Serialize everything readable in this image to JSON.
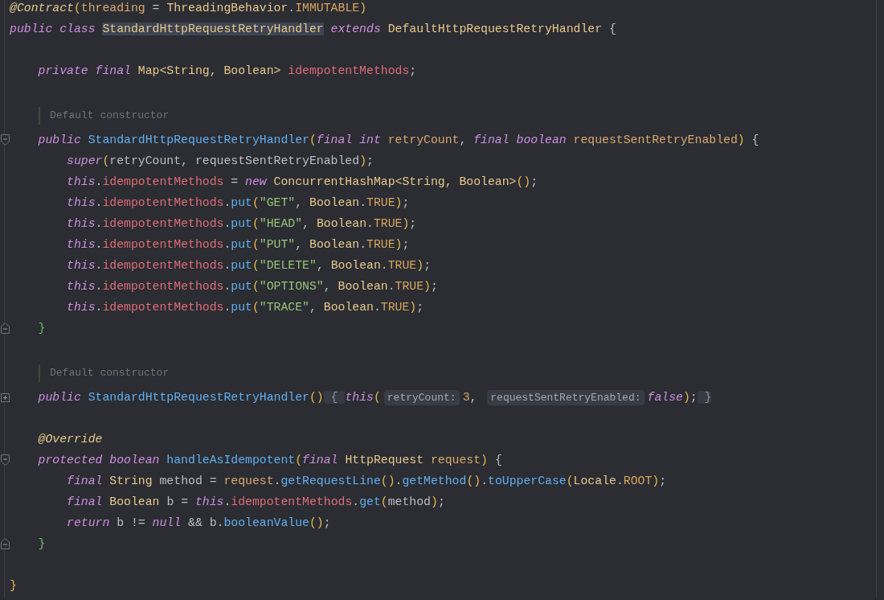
{
  "editor": {
    "lines": [
      {
        "kind": "code",
        "tokens": [
          {
            "kind": "ann",
            "text": "@Contract"
          },
          {
            "kind": "paren",
            "text": "("
          },
          {
            "kind": "param",
            "text": "threading"
          },
          {
            "kind": "plain",
            "text": " = "
          },
          {
            "kind": "type",
            "text": "ThreadingBehavior"
          },
          {
            "kind": "plain",
            "text": "."
          },
          {
            "kind": "const",
            "text": "IMMUTABLE"
          },
          {
            "kind": "paren",
            "text": ")"
          }
        ]
      },
      {
        "kind": "code",
        "tokens": [
          {
            "kind": "kw",
            "text": "public class "
          },
          {
            "kind": "hl",
            "text": "StandardHttpRequestRetryHandler"
          },
          {
            "kind": "kw",
            "text": " extends "
          },
          {
            "kind": "type",
            "text": "DefaultHttpRequestRetryHandler"
          },
          {
            "kind": "plain",
            "text": " {"
          }
        ]
      },
      {
        "kind": "blank"
      },
      {
        "kind": "code",
        "tokens": [
          {
            "kind": "kw",
            "text": "    private final "
          },
          {
            "kind": "type",
            "text": "Map<String, Boolean> "
          },
          {
            "kind": "field",
            "text": "idempotentMethods"
          },
          {
            "kind": "plain",
            "text": ";"
          }
        ]
      },
      {
        "kind": "blank"
      },
      {
        "kind": "doc",
        "text": "Default constructor"
      },
      {
        "kind": "fold-start",
        "tokens": [
          {
            "kind": "kw",
            "text": "    public "
          },
          {
            "kind": "fn",
            "text": "StandardHttpRequestRetryHandler"
          },
          {
            "kind": "paren",
            "text": "("
          },
          {
            "kind": "kw",
            "text": "final int "
          },
          {
            "kind": "param",
            "text": "retryCount"
          },
          {
            "kind": "plain",
            "text": ", "
          },
          {
            "kind": "kw",
            "text": "final boolean "
          },
          {
            "kind": "param",
            "text": "requestSentRetryEnabled"
          },
          {
            "kind": "paren",
            "text": ")"
          },
          {
            "kind": "plain",
            "text": " {"
          }
        ]
      },
      {
        "kind": "code",
        "tokens": [
          {
            "kind": "kw",
            "text": "        super"
          },
          {
            "kind": "paren",
            "text": "("
          },
          {
            "kind": "plain",
            "text": "retryCount, requestSentRetryEnabled"
          },
          {
            "kind": "paren",
            "text": ")"
          },
          {
            "kind": "plain",
            "text": ";"
          }
        ]
      },
      {
        "kind": "code",
        "tokens": [
          {
            "kind": "kw",
            "text": "        this"
          },
          {
            "kind": "plain",
            "text": "."
          },
          {
            "kind": "field",
            "text": "idempotentMethods"
          },
          {
            "kind": "plain",
            "text": " = "
          },
          {
            "kind": "kw",
            "text": "new "
          },
          {
            "kind": "type",
            "text": "ConcurrentHashMap<String, Boolean>"
          },
          {
            "kind": "paren",
            "text": "()"
          },
          {
            "kind": "plain",
            "text": ";"
          }
        ]
      },
      {
        "kind": "code",
        "tokens": [
          {
            "kind": "kw",
            "text": "        this"
          },
          {
            "kind": "plain",
            "text": "."
          },
          {
            "kind": "field",
            "text": "idempotentMethods"
          },
          {
            "kind": "plain",
            "text": "."
          },
          {
            "kind": "fn",
            "text": "put"
          },
          {
            "kind": "paren",
            "text": "("
          },
          {
            "kind": "str",
            "text": "\"GET\""
          },
          {
            "kind": "plain",
            "text": ", "
          },
          {
            "kind": "type",
            "text": "Boolean"
          },
          {
            "kind": "plain",
            "text": "."
          },
          {
            "kind": "const",
            "text": "TRUE"
          },
          {
            "kind": "paren",
            "text": ")"
          },
          {
            "kind": "plain",
            "text": ";"
          }
        ]
      },
      {
        "kind": "code",
        "tokens": [
          {
            "kind": "kw",
            "text": "        this"
          },
          {
            "kind": "plain",
            "text": "."
          },
          {
            "kind": "field",
            "text": "idempotentMethods"
          },
          {
            "kind": "plain",
            "text": "."
          },
          {
            "kind": "fn",
            "text": "put"
          },
          {
            "kind": "paren",
            "text": "("
          },
          {
            "kind": "str",
            "text": "\"HEAD\""
          },
          {
            "kind": "plain",
            "text": ", "
          },
          {
            "kind": "type",
            "text": "Boolean"
          },
          {
            "kind": "plain",
            "text": "."
          },
          {
            "kind": "const",
            "text": "TRUE"
          },
          {
            "kind": "paren",
            "text": ")"
          },
          {
            "kind": "plain",
            "text": ";"
          }
        ]
      },
      {
        "kind": "code",
        "tokens": [
          {
            "kind": "kw",
            "text": "        this"
          },
          {
            "kind": "plain",
            "text": "."
          },
          {
            "kind": "field",
            "text": "idempotentMethods"
          },
          {
            "kind": "plain",
            "text": "."
          },
          {
            "kind": "fn",
            "text": "put"
          },
          {
            "kind": "paren",
            "text": "("
          },
          {
            "kind": "str",
            "text": "\"PUT\""
          },
          {
            "kind": "plain",
            "text": ", "
          },
          {
            "kind": "type",
            "text": "Boolean"
          },
          {
            "kind": "plain",
            "text": "."
          },
          {
            "kind": "const",
            "text": "TRUE"
          },
          {
            "kind": "paren",
            "text": ")"
          },
          {
            "kind": "plain",
            "text": ";"
          }
        ]
      },
      {
        "kind": "code",
        "tokens": [
          {
            "kind": "kw",
            "text": "        this"
          },
          {
            "kind": "plain",
            "text": "."
          },
          {
            "kind": "field",
            "text": "idempotentMethods"
          },
          {
            "kind": "plain",
            "text": "."
          },
          {
            "kind": "fn",
            "text": "put"
          },
          {
            "kind": "paren",
            "text": "("
          },
          {
            "kind": "str",
            "text": "\"DELETE\""
          },
          {
            "kind": "plain",
            "text": ", "
          },
          {
            "kind": "type",
            "text": "Boolean"
          },
          {
            "kind": "plain",
            "text": "."
          },
          {
            "kind": "const",
            "text": "TRUE"
          },
          {
            "kind": "paren",
            "text": ")"
          },
          {
            "kind": "plain",
            "text": ";"
          }
        ]
      },
      {
        "kind": "code",
        "tokens": [
          {
            "kind": "kw",
            "text": "        this"
          },
          {
            "kind": "plain",
            "text": "."
          },
          {
            "kind": "field",
            "text": "idempotentMethods"
          },
          {
            "kind": "plain",
            "text": "."
          },
          {
            "kind": "fn",
            "text": "put"
          },
          {
            "kind": "paren",
            "text": "("
          },
          {
            "kind": "str",
            "text": "\"OPTIONS\""
          },
          {
            "kind": "plain",
            "text": ", "
          },
          {
            "kind": "type",
            "text": "Boolean"
          },
          {
            "kind": "plain",
            "text": "."
          },
          {
            "kind": "const",
            "text": "TRUE"
          },
          {
            "kind": "paren",
            "text": ")"
          },
          {
            "kind": "plain",
            "text": ";"
          }
        ]
      },
      {
        "kind": "code",
        "tokens": [
          {
            "kind": "kw",
            "text": "        this"
          },
          {
            "kind": "plain",
            "text": "."
          },
          {
            "kind": "field",
            "text": "idempotentMethods"
          },
          {
            "kind": "plain",
            "text": "."
          },
          {
            "kind": "fn",
            "text": "put"
          },
          {
            "kind": "paren",
            "text": "("
          },
          {
            "kind": "str",
            "text": "\"TRACE\""
          },
          {
            "kind": "plain",
            "text": ", "
          },
          {
            "kind": "type",
            "text": "Boolean"
          },
          {
            "kind": "plain",
            "text": "."
          },
          {
            "kind": "const",
            "text": "TRUE"
          },
          {
            "kind": "paren",
            "text": ")"
          },
          {
            "kind": "plain",
            "text": ";"
          }
        ]
      },
      {
        "kind": "fold-end",
        "tokens": [
          {
            "kind": "brace",
            "text": "    }"
          }
        ]
      },
      {
        "kind": "blank"
      },
      {
        "kind": "doc",
        "text": "Default constructor"
      },
      {
        "kind": "folded",
        "tokens": [
          {
            "kind": "kw",
            "text": "    public "
          },
          {
            "kind": "fn",
            "text": "StandardHttpRequestRetryHandler"
          },
          {
            "kind": "paren",
            "text": "()"
          },
          {
            "kind": "folded",
            "text": " { "
          },
          {
            "kind": "kw",
            "text": "this"
          },
          {
            "kind": "paren",
            "text": "("
          },
          {
            "kind": "inlay",
            "text": "retryCount:"
          },
          {
            "kind": "const",
            "text": "3"
          },
          {
            "kind": "plain",
            "text": ", "
          },
          {
            "kind": "inlay",
            "text": "requestSentRetryEnabled:"
          },
          {
            "kind": "kw",
            "text": "false"
          },
          {
            "kind": "paren",
            "text": ")"
          },
          {
            "kind": "plain",
            "text": ";"
          },
          {
            "kind": "folded",
            "text": " }"
          }
        ]
      },
      {
        "kind": "blank"
      },
      {
        "kind": "code",
        "tokens": [
          {
            "kind": "ann",
            "text": "    @Override"
          }
        ]
      },
      {
        "kind": "fold-start",
        "tokens": [
          {
            "kind": "kw",
            "text": "    protected boolean "
          },
          {
            "kind": "fn",
            "text": "handleAsIdempotent"
          },
          {
            "kind": "paren",
            "text": "("
          },
          {
            "kind": "kw",
            "text": "final "
          },
          {
            "kind": "type",
            "text": "HttpRequest "
          },
          {
            "kind": "param",
            "text": "request"
          },
          {
            "kind": "paren",
            "text": ")"
          },
          {
            "kind": "plain",
            "text": " {"
          }
        ]
      },
      {
        "kind": "code",
        "tokens": [
          {
            "kind": "kw",
            "text": "        final "
          },
          {
            "kind": "type",
            "text": "String"
          },
          {
            "kind": "plain",
            "text": " method = "
          },
          {
            "kind": "param",
            "text": "request"
          },
          {
            "kind": "plain",
            "text": "."
          },
          {
            "kind": "fn",
            "text": "getRequestLine"
          },
          {
            "kind": "paren",
            "text": "()"
          },
          {
            "kind": "plain",
            "text": "."
          },
          {
            "kind": "fn",
            "text": "getMethod"
          },
          {
            "kind": "paren",
            "text": "()"
          },
          {
            "kind": "plain",
            "text": "."
          },
          {
            "kind": "fn",
            "text": "toUpperCase"
          },
          {
            "kind": "paren",
            "text": "("
          },
          {
            "kind": "type",
            "text": "Locale"
          },
          {
            "kind": "plain",
            "text": "."
          },
          {
            "kind": "const",
            "text": "ROOT"
          },
          {
            "kind": "paren",
            "text": ")"
          },
          {
            "kind": "plain",
            "text": ";"
          }
        ]
      },
      {
        "kind": "code",
        "tokens": [
          {
            "kind": "kw",
            "text": "        final "
          },
          {
            "kind": "type",
            "text": "Boolean"
          },
          {
            "kind": "plain",
            "text": " b = "
          },
          {
            "kind": "kw",
            "text": "this"
          },
          {
            "kind": "plain",
            "text": "."
          },
          {
            "kind": "field",
            "text": "idempotentMethods"
          },
          {
            "kind": "plain",
            "text": "."
          },
          {
            "kind": "fn",
            "text": "get"
          },
          {
            "kind": "paren",
            "text": "("
          },
          {
            "kind": "plain",
            "text": "method"
          },
          {
            "kind": "paren",
            "text": ")"
          },
          {
            "kind": "plain",
            "text": ";"
          }
        ]
      },
      {
        "kind": "code",
        "tokens": [
          {
            "kind": "kw",
            "text": "        return"
          },
          {
            "kind": "plain",
            "text": " b != "
          },
          {
            "kind": "kw",
            "text": "null"
          },
          {
            "kind": "plain",
            "text": " && b."
          },
          {
            "kind": "fn",
            "text": "booleanValue"
          },
          {
            "kind": "paren",
            "text": "()"
          },
          {
            "kind": "plain",
            "text": ";"
          }
        ]
      },
      {
        "kind": "fold-end",
        "tokens": [
          {
            "kind": "brace",
            "text": "    }"
          }
        ]
      },
      {
        "kind": "blank"
      },
      {
        "kind": "code",
        "tokens": [
          {
            "kind": "paren",
            "text": "}"
          }
        ]
      }
    ]
  }
}
